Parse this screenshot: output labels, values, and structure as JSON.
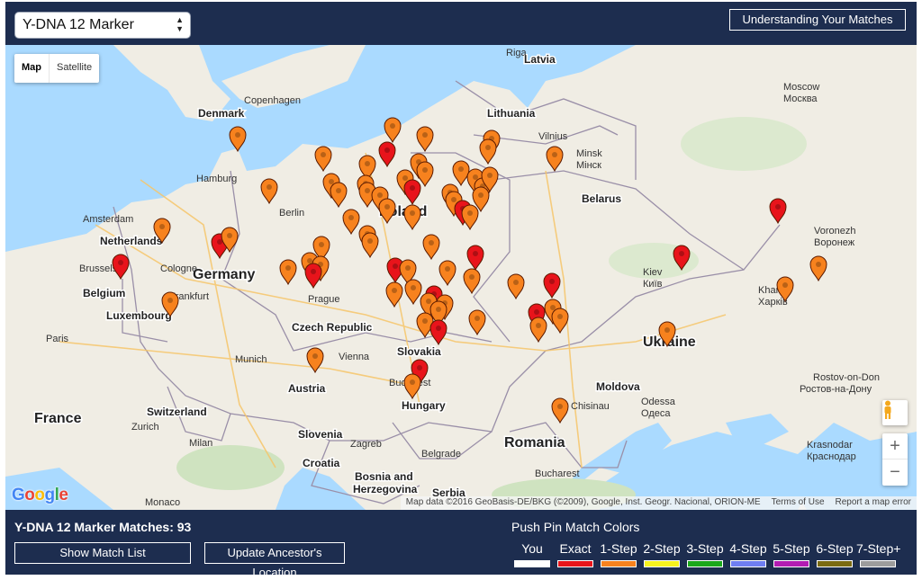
{
  "header": {
    "test_select": "Y-DNA 12 Marker",
    "understanding_button": "Understanding Your Matches"
  },
  "map": {
    "type_buttons": [
      "Map",
      "Satellite"
    ],
    "active_type": "Map",
    "google_logo": "Google",
    "zoom_in": "+",
    "zoom_out": "−",
    "attribution": {
      "data": "Map data ©2016 GeoBasis-DE/BKG (©2009), Google, Inst. Geogr. Nacional, ORION-ME",
      "terms": "Terms of Use",
      "report": "Report a map error"
    },
    "countries": [
      "Latvia",
      "Lithuania",
      "Belarus",
      "Netherlands",
      "Germany",
      "Poland",
      "Belgium",
      "Luxembourg",
      "Czech Republic",
      "Slovakia",
      "Ukraine",
      "France",
      "Switzerland",
      "Austria",
      "Hungary",
      "Slovenia",
      "Croatia",
      "Moldova",
      "Romania",
      "Bosnia and Herzegovina",
      "Serbia",
      "Denmark"
    ],
    "cities": [
      "Riga",
      "Copenhagen",
      "Vilnius",
      "Moscow Москва",
      "Minsk Мінск",
      "Hamburg",
      "Berlin",
      "Amsterdam",
      "Brussels",
      "Cologne",
      "Frankfurt",
      "Prague",
      "Voronezh Воронеж",
      "Kiev Київ",
      "Kharkiv Харків",
      "Paris",
      "Munich",
      "Vienna",
      "Budapest",
      "Chisinau",
      "Odessa Одеса",
      "Rostov-on-Don Ростов-на-Дону",
      "Zurich",
      "Milan",
      "Zagreb",
      "Belgrade",
      "Krasnodar Краснодар",
      "Bucharest",
      "Monaco"
    ]
  },
  "footer": {
    "matches_label": "Y-DNA 12 Marker Matches: 93",
    "show_list_button": "Show Match List",
    "update_location_button": "Update Ancestor's Location",
    "legend_title": "Push Pin Match Colors",
    "legend": [
      {
        "label": "You",
        "color": "#ffffff"
      },
      {
        "label": "Exact",
        "color": "#e8141b"
      },
      {
        "label": "1-Step",
        "color": "#f7821e"
      },
      {
        "label": "2-Step",
        "color": "#f7f31e"
      },
      {
        "label": "3-Step",
        "color": "#1ba81b"
      },
      {
        "label": "4-Step",
        "color": "#6f7ef2"
      },
      {
        "label": "5-Step",
        "color": "#b21bb2"
      },
      {
        "label": "6-Step",
        "color": "#7a6a12"
      },
      {
        "label": "7-Step+",
        "color": "#9c9c9c"
      }
    ]
  },
  "pin_colors": {
    "exact": "#e8141b",
    "one_step": "#f7821e"
  }
}
